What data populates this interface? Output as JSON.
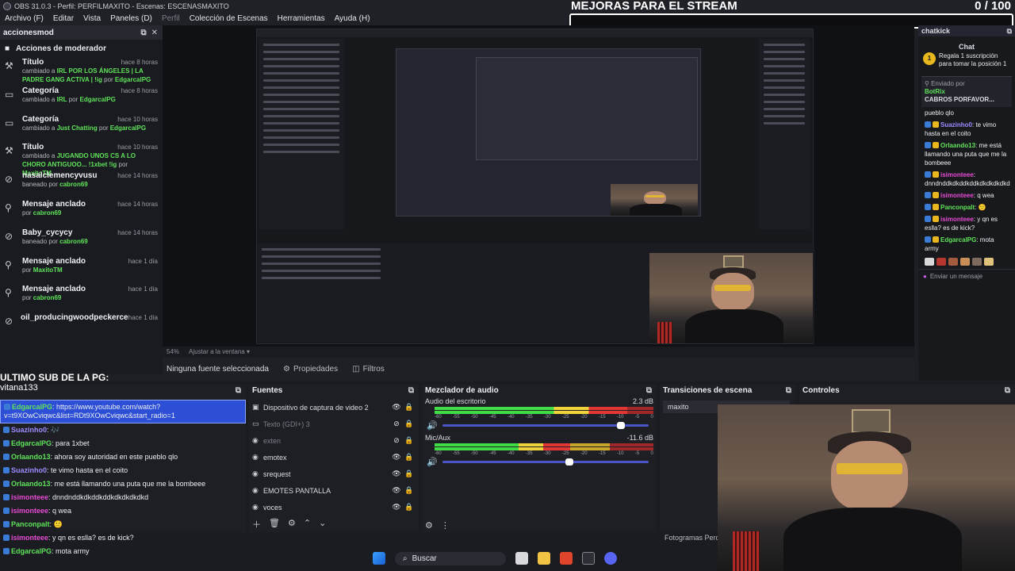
{
  "window": {
    "title": "OBS 31.0.3 - Perfil: PERFILMAXITO - Escenas: ESCENASMAXITO"
  },
  "menu": [
    {
      "label": "Archivo (F)",
      "dim": false
    },
    {
      "label": "Editar",
      "dim": false
    },
    {
      "label": "Vista",
      "dim": false
    },
    {
      "label": "Paneles (D)",
      "dim": false
    },
    {
      "label": "Perfil",
      "dim": true
    },
    {
      "label": "Colección de Escenas",
      "dim": false
    },
    {
      "label": "Herramientas",
      "dim": false
    },
    {
      "label": "Ayuda (H)",
      "dim": false
    }
  ],
  "goal": {
    "label": "MEJORAS PARA EL STREAM",
    "count": "0 / 100",
    "progress": 0.0
  },
  "mod_dock": {
    "title": "accionesmod",
    "heading": "Acciones de moderador",
    "actions": [
      {
        "icon": "⚒",
        "title": "Título",
        "time": "hace 8 horas",
        "pre": "cambiado a ",
        "value": "IRL POR LOS ÁNGELES | LA PADRE GANG ACTIVA | !ig",
        "mid": " por ",
        "user": "EdgarcalPG"
      },
      {
        "icon": "▭",
        "title": "Categoría",
        "time": "hace 8 horas",
        "pre": "cambiado a ",
        "value": "IRL",
        "mid": " por ",
        "user": "EdgarcalPG"
      },
      {
        "icon": "▭",
        "title": "Categoría",
        "time": "hace 10 horas",
        "pre": "cambiado a ",
        "value": "Just Chatting",
        "mid": " por ",
        "user": "EdgarcalPG"
      },
      {
        "icon": "⚒",
        "title": "Título",
        "time": "hace 10 horas",
        "pre": "cambiado a ",
        "value": "JUGANDO UNOS CS A LO CHORO ANTIGUOO... !1xbet !ig",
        "mid": " por ",
        "user": "MaxitoTM"
      },
      {
        "icon": "⊘",
        "title": "nasalclemencyvusu",
        "time": "hace 14 horas",
        "pre": "baneado por ",
        "value": "",
        "mid": "",
        "user": "cabron69"
      },
      {
        "icon": "⚲",
        "title": "Mensaje anclado",
        "time": "hace 14 horas",
        "pre": "por ",
        "value": "",
        "mid": "",
        "user": "cabron69"
      },
      {
        "icon": "⊘",
        "title": "Baby_cycycy",
        "time": "hace 14 horas",
        "pre": "baneado por ",
        "value": "",
        "mid": "",
        "user": "cabron69"
      },
      {
        "icon": "⚲",
        "title": "Mensaje anclado",
        "time": "hace 1 día",
        "pre": "por ",
        "value": "",
        "mid": "",
        "user": "MaxitoTM"
      },
      {
        "icon": "⚲",
        "title": "Mensaje anclado",
        "time": "hace 1 día",
        "pre": "por ",
        "value": "",
        "mid": "",
        "user": "cabron69"
      },
      {
        "icon": "⊘",
        "title": "oil_producingwoodpeckerce",
        "time": "hace 1 día",
        "pre": "",
        "value": "",
        "mid": "",
        "user": ""
      }
    ]
  },
  "preview": {
    "zoom": "54%",
    "zoom_mode": "Ajustar a la ventana",
    "no_source": "Ninguna fuente seleccionada",
    "props_btn": "Propiedades",
    "filters_btn": "Filtros"
  },
  "chat_dock": {
    "title": "chatkick",
    "label": "Chat",
    "gift_text": "Regala 1 suscripción para tomar la posición 1",
    "gift_rank": "1",
    "pinned_head": "Enviado por",
    "pinned_user": "BotRix",
    "pinned_text": "CABROS PORFAVOR...",
    "messages": [
      {
        "user": "",
        "text": "pueblo qlo",
        "color": "#ffffff"
      },
      {
        "user": "Suazinho0",
        "text": ": te vimo hasta en el coito",
        "color": "#9b8cff"
      },
      {
        "user": "Orlaando13",
        "text": ": me está llamando una puta que me la bombeee",
        "color": "#5fe35a"
      },
      {
        "user": "isimonteee",
        "text": ": dnndnddkdkddkddkdkdkdkdkd",
        "color": "#e84bd4"
      },
      {
        "user": "isimonteee",
        "text": ": q wea",
        "color": "#e84bd4"
      },
      {
        "user": "Panconpalt",
        "text": ": 🙂",
        "color": "#5fe35a"
      },
      {
        "user": "isimonteee",
        "text": ": y qn es eslla? es de kick?",
        "color": "#e84bd4"
      },
      {
        "user": "EdgarcalPG",
        "text": ": mota army",
        "color": "#5fe35a"
      }
    ],
    "send_label": "Enviar un mensaje"
  },
  "last_sub": {
    "label": "ULTIMO SUB DE LA PG:",
    "name": "vitana133"
  },
  "chat_overlay": [
    {
      "user": "EdgarcalPG",
      "text": ": https://www.youtube.com/watch?v=t9XOwCviqwc&list=RDt9XOwCviqwc&start_radio=1",
      "color": "#5fe35a",
      "highlight": true
    },
    {
      "user": "Suazinho0",
      "text": ": 🎶",
      "color": "#9b8cff",
      "highlight": false
    },
    {
      "user": "EdgarcalPG",
      "text": ": para 1xbet",
      "color": "#5fe35a",
      "highlight": false
    },
    {
      "user": "Orlaando13",
      "text": ": ahora soy autoridad en este pueblo qlo",
      "color": "#5fe35a",
      "highlight": false
    },
    {
      "user": "Suazinho0",
      "text": ": te vimo hasta en el coito",
      "color": "#9b8cff",
      "highlight": false
    },
    {
      "user": "Orlaando13",
      "text": ": me está llamando una puta que me la bombeee",
      "color": "#5fe35a",
      "highlight": false
    },
    {
      "user": "isimonteee",
      "text": ": dnndnddkdkddkddkdkdkdkdkd",
      "color": "#e84bd4",
      "highlight": false
    },
    {
      "user": "isimonteee",
      "text": ": q wea",
      "color": "#e84bd4",
      "highlight": false
    },
    {
      "user": "Panconpalt",
      "text": ": 🙂",
      "color": "#5fe35a",
      "highlight": false
    },
    {
      "user": "isimonteee",
      "text": ": y qn es eslla? es de kick?",
      "color": "#e84bd4",
      "highlight": false
    },
    {
      "user": "EdgarcalPG",
      "text": ": mota army",
      "color": "#5fe35a",
      "highlight": false
    }
  ],
  "sources_dock": {
    "title": "Fuentes",
    "items": [
      {
        "icon": "▣",
        "name": "Dispositivo de captura de video 2",
        "visible": true,
        "dim": false
      },
      {
        "icon": "▭",
        "name": "Texto (GDI+) 3",
        "visible": false,
        "dim": true
      },
      {
        "icon": "◉",
        "name": "exten",
        "visible": false,
        "dim": true
      },
      {
        "icon": "◉",
        "name": "emotex",
        "visible": true,
        "dim": false
      },
      {
        "icon": "◉",
        "name": "srequest",
        "visible": true,
        "dim": false
      },
      {
        "icon": "◉",
        "name": "EMOTES PANTALLA",
        "visible": true,
        "dim": false
      },
      {
        "icon": "◉",
        "name": "voces",
        "visible": true,
        "dim": false
      }
    ]
  },
  "mixer_dock": {
    "title": "Mezclador de audio",
    "tracks": [
      {
        "name": "Audio del escritorio",
        "db": "2.3 dB",
        "level": 0.88,
        "volume": 0.88
      },
      {
        "name": "Mic/Aux",
        "db": "-11.6 dB",
        "level": 0.62,
        "volume": 0.62
      }
    ],
    "scale": [
      "-60",
      "-55",
      "-50",
      "-45",
      "-40",
      "-35",
      "-30",
      "-25",
      "-20",
      "-15",
      "-10",
      "-5",
      "0"
    ]
  },
  "transitions_dock": {
    "title": "Transiciones de escena",
    "selected": "maxito"
  },
  "controls_dock": {
    "title": "Controles"
  },
  "status": {
    "frames": "Fotogramas Perd"
  },
  "taskbar": {
    "search": "Buscar"
  }
}
